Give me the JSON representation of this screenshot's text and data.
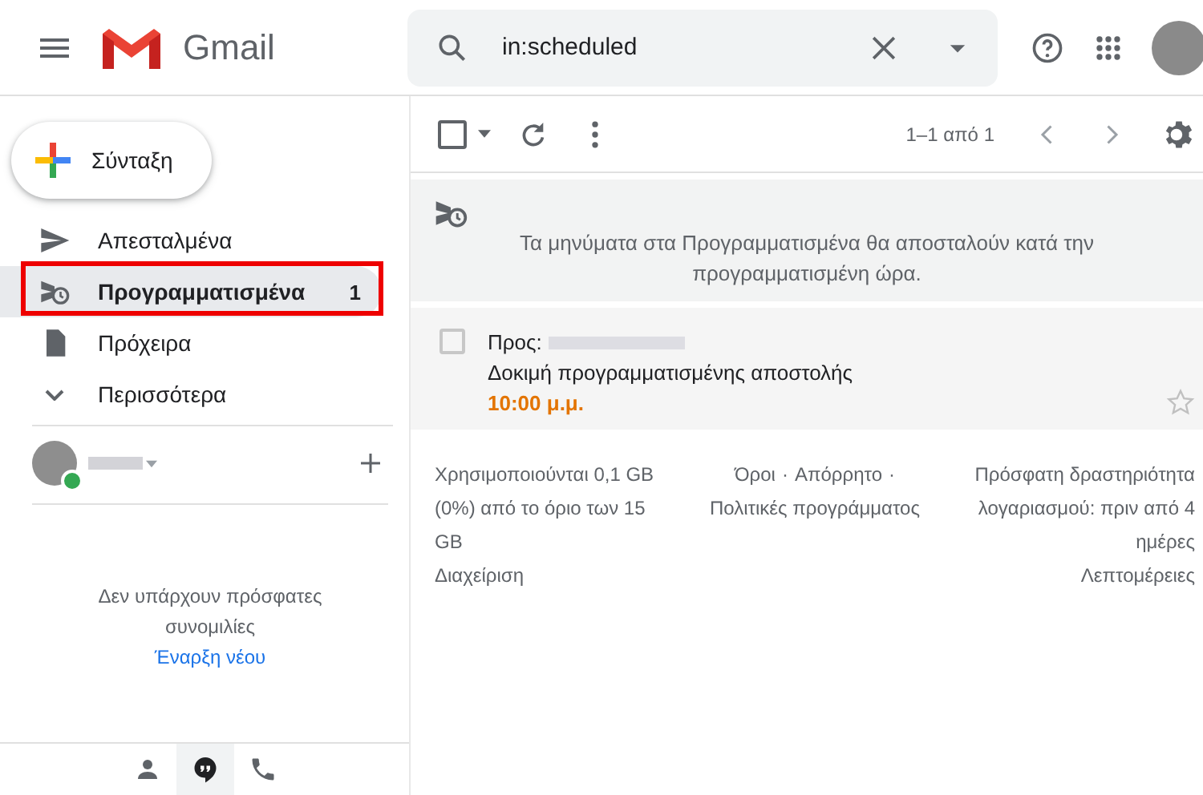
{
  "header": {
    "app_name": "Gmail",
    "search": {
      "value": "in:scheduled"
    }
  },
  "compose": {
    "label": "Σύνταξη"
  },
  "sidebar": {
    "items": [
      {
        "kind": "sent",
        "label": "Απεσταλμένα",
        "selected": false,
        "highlighted": false
      },
      {
        "kind": "scheduled",
        "label": "Προγραμματισμένα",
        "count": "1",
        "selected": true,
        "highlighted": true
      },
      {
        "kind": "drafts",
        "label": "Πρόχειρα",
        "selected": false,
        "highlighted": false
      },
      {
        "kind": "more",
        "label": "Περισσότερα",
        "selected": false,
        "highlighted": false
      }
    ]
  },
  "chat": {
    "online": true,
    "empty_text": "Δεν υπάρχουν πρόσφατες συνομιλίες",
    "start_link": "Έναρξη νέου",
    "tabs": [
      {
        "kind": "contacts",
        "selected": false
      },
      {
        "kind": "chat",
        "selected": true
      },
      {
        "kind": "phone",
        "selected": false
      }
    ]
  },
  "toolbar": {
    "select_all_checked": false,
    "page_info": "1–1 από 1"
  },
  "notice": {
    "text": "Τα μηνύματα στα Προγραμματισμένα θα αποσταλούν κατά την προγραμματισμένη ώρα."
  },
  "messages": [
    {
      "to_label": "Προς:",
      "subject": "Δοκιμή προγραμματισμένης αποστολής",
      "time": "10:00 μ.μ.",
      "checked": false,
      "starred": false
    }
  ],
  "footer": {
    "storage": "Χρησιμοποιούνται 0,1 GB (0%) από το όριο των 15 GB",
    "manage": "Διαχείριση",
    "links": [
      "Όροι",
      "Απόρρητο",
      "Πολιτικές προγράμματος"
    ],
    "link_separators": [
      "·",
      "·"
    ],
    "activity": "Πρόσφατη δραστηριότητα λογαριασμού: πριν από 4 ημέρες",
    "details": "Λεπτομέρειες"
  }
}
